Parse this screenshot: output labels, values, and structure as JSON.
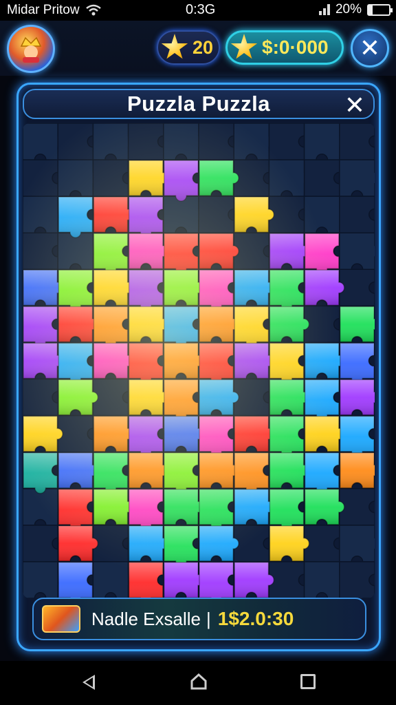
{
  "status_bar": {
    "carrier": "Midar Pritow",
    "time": "0:3G",
    "battery_percent": "20%",
    "battery_level": 0.2
  },
  "hud": {
    "avatar_icon": "king-avatar-icon",
    "stars_icon": "star-icon",
    "stars_value": "20",
    "coins_icon": "star-coin-icon",
    "coins_value": "$:0·000",
    "close_icon": "close-icon"
  },
  "panel": {
    "title": "Puzzla Puzzla",
    "close_icon": "close-icon"
  },
  "bottom_bar": {
    "icon": "puzzle-pieces-icon",
    "label": "Nadle Exsalle",
    "separator": "|",
    "amount": "1$2.0:30"
  },
  "nav": {
    "back_icon": "back-triangle-icon",
    "home_icon": "home-icon",
    "recent_icon": "recent-apps-icon"
  },
  "colors": {
    "panel_border": "#3aa7ff",
    "coin_text": "#ffe85a",
    "amount_text": "#f6d93c",
    "board_background": "#0e1a34",
    "piece_colors": [
      "#ff2a2a",
      "#ff8c1a",
      "#ffd21a",
      "#7cf02a",
      "#1ee05a",
      "#1aa8ff",
      "#3a6aff",
      "#a03aff",
      "#ff3ac8",
      "#18b0a0"
    ]
  },
  "puzzle": {
    "columns": 10,
    "rows": 13,
    "grid": [
      [
        -1,
        -1,
        -1,
        -1,
        -1,
        -1,
        -1,
        -1,
        -1,
        -1
      ],
      [
        -1,
        -1,
        -1,
        2,
        7,
        4,
        -1,
        -1,
        -1,
        -1
      ],
      [
        -1,
        5,
        0,
        7,
        -1,
        -1,
        2,
        -1,
        -1,
        -1
      ],
      [
        -1,
        -1,
        3,
        8,
        0,
        0,
        -1,
        7,
        8,
        -1
      ],
      [
        6,
        3,
        2,
        7,
        3,
        8,
        5,
        4,
        7,
        -1
      ],
      [
        7,
        0,
        1,
        2,
        5,
        1,
        2,
        4,
        -1,
        4
      ],
      [
        7,
        5,
        8,
        0,
        1,
        0,
        7,
        2,
        5,
        6
      ],
      [
        -1,
        3,
        -1,
        2,
        1,
        5,
        -1,
        4,
        5,
        7
      ],
      [
        2,
        -1,
        1,
        7,
        6,
        8,
        0,
        4,
        2,
        5
      ],
      [
        9,
        6,
        4,
        1,
        3,
        1,
        1,
        4,
        5,
        1
      ],
      [
        -1,
        0,
        3,
        8,
        4,
        4,
        5,
        4,
        4,
        -1
      ],
      [
        -1,
        0,
        -1,
        5,
        4,
        5,
        -1,
        2,
        -1,
        -1
      ],
      [
        -1,
        6,
        -1,
        0,
        7,
        7,
        7,
        -1,
        -1,
        -1
      ]
    ]
  }
}
